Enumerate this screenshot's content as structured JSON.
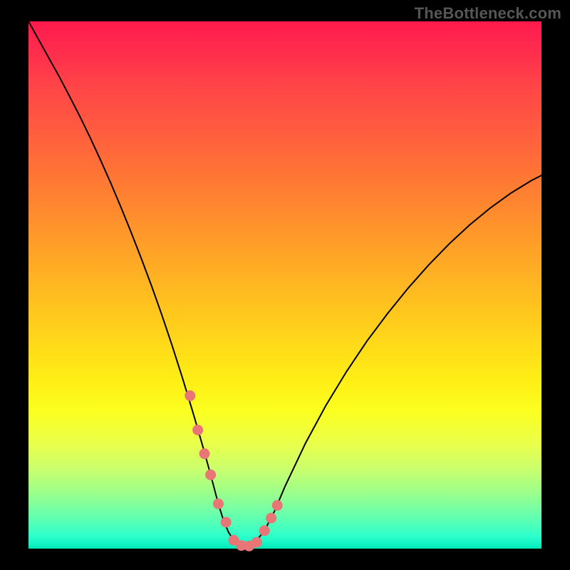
{
  "watermark": "TheBottleneck.com",
  "chart_data": {
    "type": "line",
    "title": "",
    "xlabel": "",
    "ylabel": "",
    "xlim": [
      0,
      100
    ],
    "ylim": [
      0,
      100
    ],
    "grid": false,
    "legend": false,
    "series": [
      {
        "name": "curve",
        "x": [
          0,
          2,
          4,
          6,
          8,
          10,
          12,
          14,
          16,
          18,
          20,
          22,
          24,
          26,
          28,
          30,
          32,
          33,
          34,
          35,
          36,
          37,
          38,
          39,
          40,
          41,
          42,
          43,
          44,
          46,
          48,
          50,
          54,
          58,
          62,
          66,
          70,
          74,
          78,
          82,
          86,
          90,
          94,
          98,
          100
        ],
        "y": [
          100,
          96.5,
          93,
          89.5,
          85.8,
          82,
          78,
          73.8,
          69.4,
          64.8,
          60,
          55,
          49.8,
          44.3,
          38.5,
          32.4,
          26,
          22.7,
          19.3,
          15.8,
          12.2,
          8.5,
          5.4,
          3.1,
          1.6,
          0.7,
          0.4,
          0.5,
          1.0,
          3.4,
          7.2,
          11.8,
          20.0,
          27.2,
          33.6,
          39.4,
          44.6,
          49.4,
          53.8,
          57.8,
          61.4,
          64.6,
          67.4,
          69.8,
          70.8
        ]
      }
    ],
    "markers": {
      "name": "highlight-dots",
      "color": "#e97676",
      "x": [
        31.5,
        33.0,
        34.3,
        35.5,
        37.0,
        38.5,
        40.0,
        41.5,
        43.0,
        44.5,
        46.0,
        47.3,
        48.5
      ],
      "y": [
        29.0,
        22.5,
        18.0,
        14.0,
        8.5,
        5.0,
        1.6,
        0.6,
        0.5,
        1.2,
        3.4,
        5.8,
        8.2
      ]
    },
    "background_gradient": {
      "top": "#ff1a4d",
      "mid": "#ffee16",
      "bottom": "#00e8b8"
    }
  }
}
